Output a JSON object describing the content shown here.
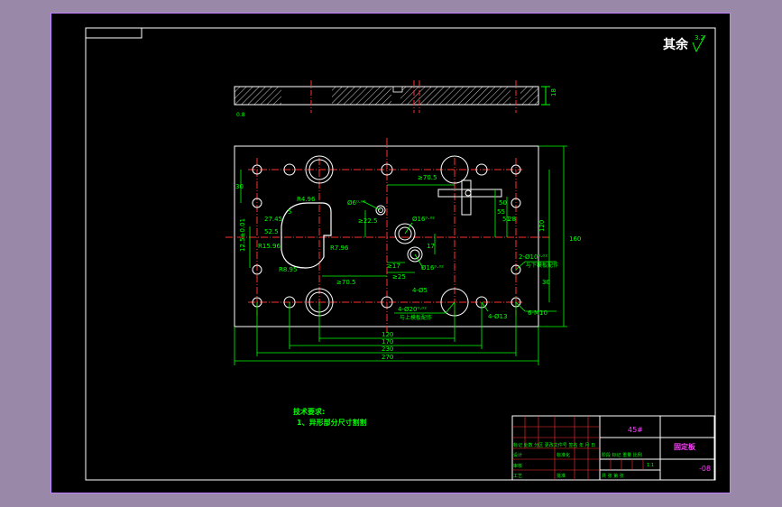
{
  "surface_note": "其余",
  "surface_symbol": "3.2",
  "notes": {
    "title": "技术要求:",
    "line1": "1、异形部分尺寸割割"
  },
  "title_block": {
    "material": "45#",
    "part_name": "固定板",
    "drawing_no": "-08",
    "scale": "1:1",
    "rev_header": "标记 处数 分区 更改文件号 签名 年 月 日",
    "design": "设计",
    "standard": "标准化",
    "review": "审核",
    "process": "工艺",
    "approve": "批准",
    "stage": "阶段 标记 重量 比例",
    "sheet": "共 张 第 张"
  },
  "side_view": {
    "thickness": "18",
    "roughness": "0.8"
  },
  "dims": {
    "w270": "270",
    "w230": "230",
    "w170": "170",
    "w120": "120",
    "h160": "160",
    "h120": "120",
    "d30": "30",
    "d30b": "30",
    "r705a": "≥70.5",
    "r705b": "≥70.5",
    "r4496": "R4.96",
    "r2796": "R7.96",
    "r1596": "R15.96",
    "r895": "R8.95",
    "d2745": "27.45",
    "d525": "52.5",
    "d5": "5",
    "d225": "≥22.5",
    "d17": "17",
    "d25": "≥25",
    "d26": "≥17",
    "d125": "12.5±0.01",
    "d50": "50",
    "d55": "55",
    "d51": "51",
    "d28": "28",
    "phi6": "Ø6⁰·⁰²",
    "phi16": "Ø16⁰·⁰²",
    "phi16b": "Ø16⁰·⁰²",
    "h4phi5": "4-Ø5",
    "h4phi20": "4-Ø20⁰·⁰²",
    "h4phi20_note": "与上模板配作",
    "h2phi10": "2-Ø10⁰·⁰²",
    "h2phi10_note": "与下模板配作",
    "h6m10": "6-M10",
    "h4d13": "4-Ø13"
  }
}
